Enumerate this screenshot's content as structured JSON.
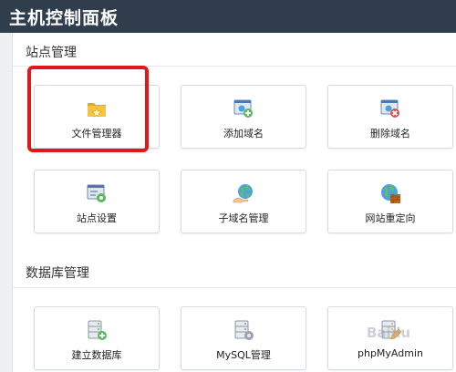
{
  "header": {
    "title": "主机控制面板"
  },
  "sections": [
    {
      "title": "站点管理",
      "tiles": [
        {
          "label": "文件管理器",
          "icon": "folder-icon"
        },
        {
          "label": "添加域名",
          "icon": "add-domain-icon"
        },
        {
          "label": "删除域名",
          "icon": "delete-domain-icon"
        },
        {
          "label": "站点设置",
          "icon": "site-settings-icon"
        },
        {
          "label": "子域名管理",
          "icon": "globe-hand-icon"
        },
        {
          "label": "网站重定向",
          "icon": "redirect-globe-icon"
        }
      ]
    },
    {
      "title": "数据库管理",
      "tiles": [
        {
          "label": "建立数据库",
          "icon": "database-add-icon"
        },
        {
          "label": "MySQL管理",
          "icon": "database-settings-icon"
        },
        {
          "label": "phpMyAdmin",
          "icon": "database-edit-icon"
        }
      ]
    }
  ],
  "watermark": {
    "text": "Baidu"
  },
  "colors": {
    "header_bg": "#2f3d4c",
    "highlight": "#e0181b",
    "tile_border": "#d6dbe1"
  }
}
